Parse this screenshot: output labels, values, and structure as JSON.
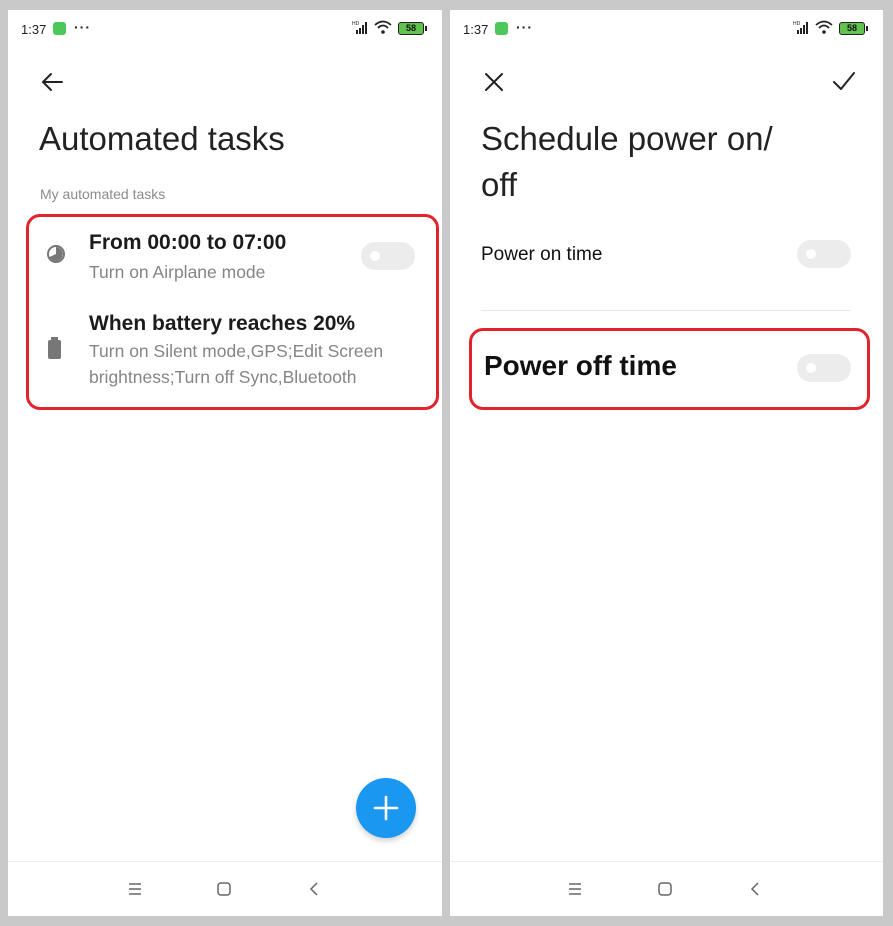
{
  "left_screen": {
    "status_bar": {
      "time": "1:37",
      "battery": "58"
    },
    "back_icon": "arrow-left-icon",
    "title": "Automated tasks",
    "section_label": "My automated tasks",
    "tasks": [
      {
        "icon": "clock-icon",
        "title": "From 00:00 to 07:00",
        "subtitle": "Turn on Airplane mode",
        "enabled": false
      },
      {
        "icon": "battery-icon",
        "title": "When battery reaches 20%",
        "subtitle": "Turn on Silent mode,GPS;Edit Screen brightness;Turn off Sync,Bluetooth"
      }
    ],
    "fab_icon": "plus-icon"
  },
  "right_screen": {
    "status_bar": {
      "time": "1:37",
      "battery": "58"
    },
    "close_icon": "close-icon",
    "confirm_icon": "checkmark-icon",
    "title_line1": "Schedule power on/",
    "title_line2": "off",
    "rows": [
      {
        "label": "Power on time",
        "enabled": false
      },
      {
        "label": "Power off time",
        "enabled": false
      }
    ]
  },
  "navbar_icons": [
    "menu-icon",
    "home-icon",
    "back-icon"
  ],
  "colors": {
    "accent": "#1a97f1",
    "highlight": "#e0242b",
    "toggle_off": "#ececec",
    "app_icon": "#4cc85a",
    "battery": "#62c24f"
  }
}
